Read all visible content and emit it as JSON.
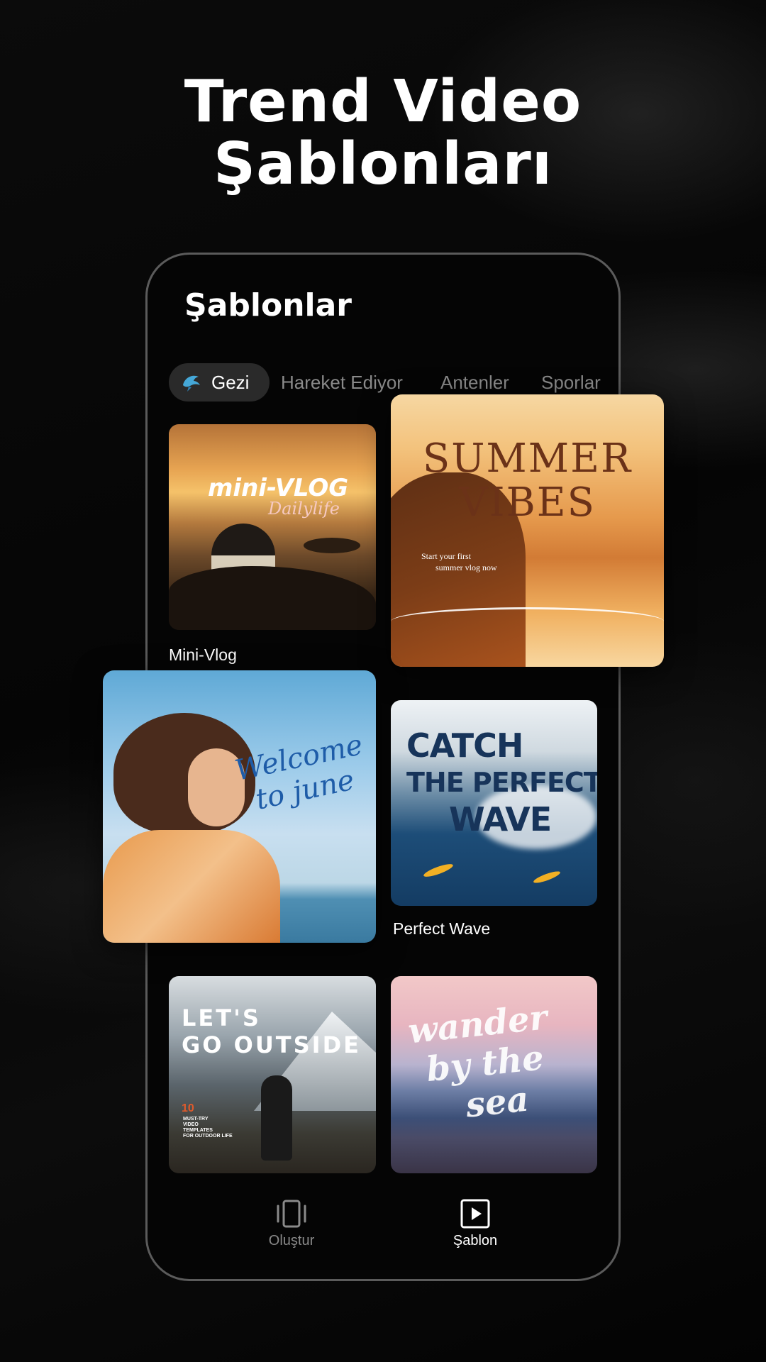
{
  "hero": {
    "title_line1": "Trend Video",
    "title_line2": "Şablonları"
  },
  "screen": {
    "title": "Şablonlar"
  },
  "tabs": [
    {
      "label": "Gezi",
      "active": true,
      "icon": "dolphin-icon"
    },
    {
      "label": "Hareket Ediyor",
      "active": false
    },
    {
      "label": "Antenler",
      "active": false
    },
    {
      "label": "Sporlar",
      "active": false
    }
  ],
  "templates": {
    "mini_vlog": {
      "thumb_title": "mini-VLOG",
      "thumb_script": "Dailylife",
      "caption": "Mini-Vlog"
    },
    "summer_vibes": {
      "thumb_title_1": "SUMMER",
      "thumb_title_2": "VIBES",
      "thumb_sub_1": "Start your first",
      "thumb_sub_2": "summer vlog now"
    },
    "welcome_june": {
      "thumb_line1": "Welcome",
      "thumb_line2": "to june"
    },
    "perfect_wave": {
      "thumb_line1": "CATCH",
      "thumb_line2": "THE PERFECT",
      "thumb_line3": "WAVE",
      "caption": "Perfect Wave"
    },
    "go_outside": {
      "thumb_line1": "LET'S",
      "thumb_line2": "GO OUTSIDE",
      "thumb_number": "10",
      "thumb_small": "MUST-TRY\nVIDEO\nTEMPLATES\nFOR OUTDOOR LIFE"
    },
    "wander_sea": {
      "thumb_line1": "wander",
      "thumb_line2": "by the",
      "thumb_line3": "sea"
    }
  },
  "bottom_nav": {
    "create": {
      "label": "Oluştur",
      "icon": "carousel-icon",
      "active": false
    },
    "template": {
      "label": "Şablon",
      "icon": "play-square-icon",
      "active": true
    }
  },
  "colors": {
    "background": "#000000",
    "phone_border": "#5b5b5b",
    "tab_active_bg": "#2a2a2a",
    "tab_inactive_text": "#8a8a8a",
    "text_primary": "#ffffff"
  }
}
